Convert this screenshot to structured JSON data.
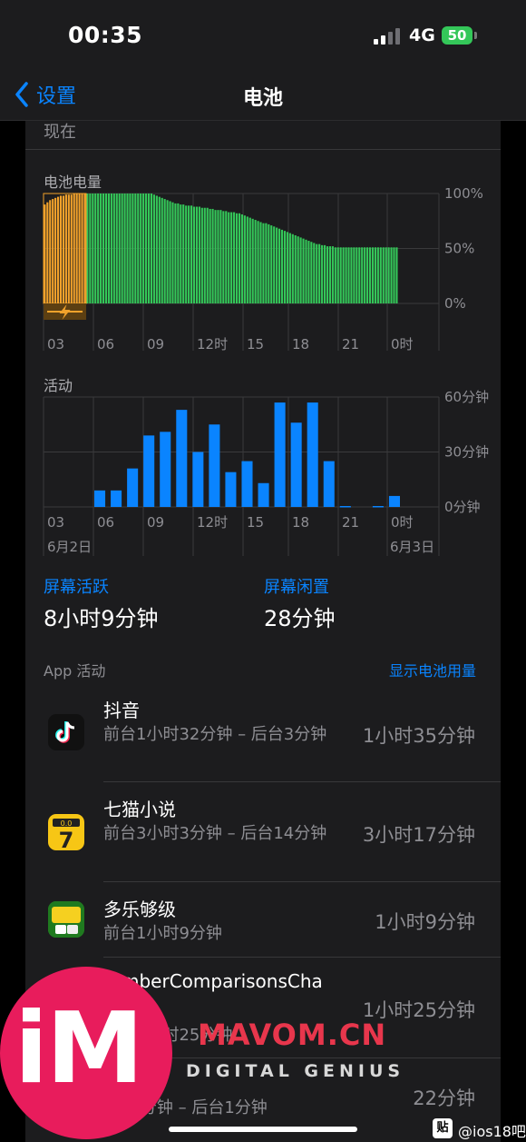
{
  "status_bar": {
    "time": "00:35",
    "network": "4G",
    "battery": "50"
  },
  "nav": {
    "back_label": "设置",
    "title": "电池"
  },
  "top_label": "现在",
  "battery_chart_label": "电池电量",
  "activity_chart_label": "活动",
  "chart_data": [
    {
      "type": "bar",
      "title": "电池电量",
      "y_ticks": [
        "100%",
        "50%",
        "0%"
      ],
      "x_ticks": [
        "03",
        "06",
        "09",
        "12时",
        "15",
        "18",
        "21",
        "0时"
      ],
      "ylim": [
        0,
        100
      ],
      "charging_range": [
        0,
        16
      ],
      "colors": {
        "charging": "#f2a22b",
        "battery": "#34c759"
      },
      "values": [
        90,
        92,
        94,
        95,
        96,
        97,
        98,
        98,
        99,
        99,
        99,
        100,
        100,
        100,
        100,
        100,
        100,
        100,
        100,
        100,
        100,
        100,
        100,
        100,
        100,
        100,
        100,
        100,
        100,
        100,
        100,
        100,
        100,
        100,
        100,
        100,
        100,
        100,
        100,
        100,
        100,
        99,
        98,
        97,
        96,
        95,
        94,
        93,
        92,
        91,
        91,
        90,
        90,
        89,
        89,
        89,
        88,
        88,
        88,
        87,
        87,
        87,
        86,
        86,
        85,
        85,
        85,
        84,
        84,
        83,
        83,
        83,
        82,
        82,
        81,
        80,
        79,
        78,
        77,
        76,
        75,
        74,
        73,
        73,
        72,
        71,
        70,
        69,
        68,
        67,
        66,
        65,
        64,
        63,
        62,
        61,
        60,
        59,
        58,
        57,
        56,
        55,
        54,
        54,
        53,
        53,
        52,
        52,
        52,
        51,
        51,
        51,
        51,
        51,
        51,
        51,
        51,
        51,
        51,
        51,
        51,
        51,
        51,
        51,
        51,
        51,
        51,
        51,
        51,
        51,
        51,
        51,
        51
      ]
    },
    {
      "type": "bar",
      "title": "活动",
      "y_ticks": [
        "60分钟",
        "30分钟",
        "0分钟"
      ],
      "ylim": [
        0,
        60
      ],
      "x_ticks": [
        "03",
        "06",
        "09",
        "12时",
        "15",
        "18",
        "21",
        "0时"
      ],
      "date_labels": [
        "6月2日",
        "6月3日"
      ],
      "color": "#0a84ff",
      "values": [
        0,
        0,
        0,
        9,
        9,
        21,
        39,
        41,
        53,
        30,
        45,
        19,
        25,
        13,
        57,
        46,
        57,
        25,
        0,
        0,
        0,
        6,
        0
      ]
    }
  ],
  "stats": {
    "active_label": "屏幕活跃",
    "active_value": "8小时9分钟",
    "idle_label": "屏幕闲置",
    "idle_value": "28分钟"
  },
  "app_section": {
    "label": "App 活动",
    "link": "显示电池用量"
  },
  "apps": [
    {
      "name": "抖音",
      "detail": "前台1小时32分钟 – 后台3分钟",
      "time": "1小时35分钟"
    },
    {
      "name": "七猫小说",
      "detail": "前台3小时3分钟 – 后台14分钟",
      "time": "3小时17分钟"
    },
    {
      "name": "多乐够级",
      "detail": "前台1小时9分钟",
      "time": "1小时9分钟"
    },
    {
      "name": "…mberComparisonsCha",
      "detail": "…台1小时25分钟",
      "time": "1小时25分钟"
    },
    {
      "name": "",
      "detail": "…21分钟 – 后台1分钟",
      "time": "22分钟"
    }
  ],
  "watermark": {
    "logo": "iM",
    "site": "MAVOM.CN",
    "tagline": "DIGITAL GENIUS"
  },
  "tieba": {
    "badge": "贴",
    "text": "@ios18吧"
  }
}
